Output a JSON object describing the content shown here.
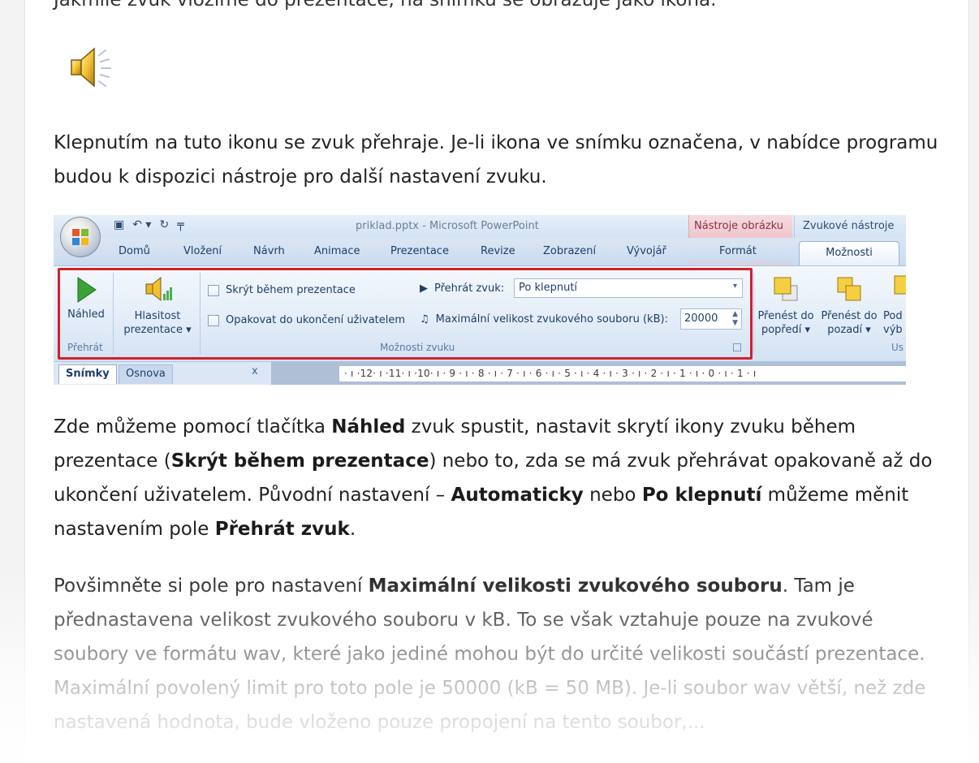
{
  "article": {
    "cut_line": "Jakmile zvuk vložíme do prezentace, na snímku se obrazuje jako ikona.",
    "p1": "Klepnutím na tuto ikonu se zvuk přehraje. Je-li ikona ve snímku označena, v nabídce programu budou k dispozici nástroje pro další nastavení zvuku.",
    "p2": {
      "t1": "Zde můžeme pomocí tlačítka ",
      "b1": "Náhled",
      "t2": " zvuk spustit, nastavit skrytí ikony zvuku během prezentace (",
      "b2": "Skrýt během prezentace",
      "t3": ") nebo to, zda se má zvuk přehrávat opakovaně až do ukončení uživatelem. Původní nastavení – ",
      "b3": "Automaticky",
      "t4": " nebo ",
      "b4": "Po klepnutí",
      "t5": " můžeme měnit nastavením pole ",
      "b5": "Přehrát zvuk",
      "t6": "."
    },
    "p3": {
      "t1": "Povšimněte si pole pro nastavení ",
      "b1": "Maximální velikosti zvukového souboru",
      "t2": ". Tam je přednastavena velikost zvukového souboru v kB. To se však vztahuje pouze na zvukové soubory ve formátu wav, které jako jediné mohou být do určité velikosti součástí prezentace. Maximální povolený limit pro toto pole je 50000 (kB = 50 MB). Je-li soubor wav větší, než zde nastavená hodnota, bude vloženo pouze propojení na tento soubor,..."
    }
  },
  "ribbon": {
    "window_title": "priklad.pptx - Microsoft PowerPoint",
    "ctx_picture_tools": "Nástroje obrázku",
    "ctx_sound_tools": "Zvukové nástroje",
    "tabs": [
      "Domů",
      "Vložení",
      "Návrh",
      "Animace",
      "Prezentace",
      "Revize",
      "Zobrazení",
      "Vývojář",
      "Formát"
    ],
    "active_tab": "Možnosti",
    "preview_label": "Náhled",
    "group_play": "Přehrát",
    "volume_label_1": "Hlasitost",
    "volume_label_2": "prezentace ▾",
    "hide_during_show": "Skrýt během prezentace",
    "loop_until_stopped": "Opakovat do ukončení uživatelem",
    "play_sound_label": "Přehrát zvuk:",
    "play_sound_value": "Po klepnutí",
    "max_size_label": "Maximální velikost zvukového souboru (kB):",
    "max_size_value": "20000",
    "group_sound_options": "Možnosti zvuku",
    "bring_forward_1": "Přenést do",
    "bring_forward_2": "popředí ▾",
    "send_backward_1": "Přenést do",
    "send_backward_2": "pozadí ▾",
    "selection_1": "Pod",
    "selection_2": "výb",
    "group_arrange": "Us",
    "pane_tab_slides": "Snímky",
    "pane_tab_outline": "Osnova",
    "pane_close": "x",
    "ruler_text": "· ı ·12· ı ·11· ı ·10· ı · 9 · ı · 8 · ı · 7 · ı · 6 · ı · 5 · ı · 4 · ı · 3 · ı · 2 · ı · 1 · ı · 0 · ı · 1 · ı"
  }
}
